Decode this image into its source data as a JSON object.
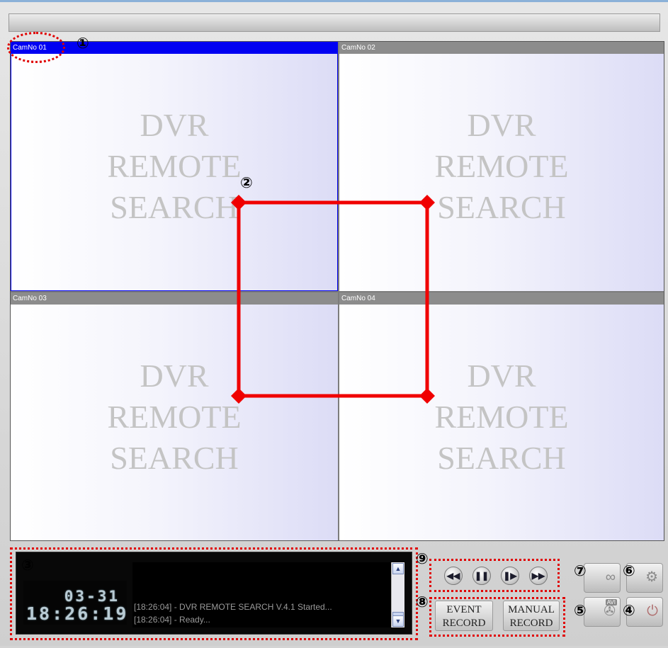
{
  "cameras": [
    {
      "label": "CamNo 01",
      "active": true
    },
    {
      "label": "CamNo 02",
      "active": false
    },
    {
      "label": "CamNo 03",
      "active": false
    },
    {
      "label": "CamNo 04",
      "active": false
    }
  ],
  "watermark": {
    "line1": "DVR",
    "line2": "REMOTE",
    "line3": "SEARCH"
  },
  "status": {
    "date": "03-31",
    "time": "18:26:19"
  },
  "log": {
    "entries": [
      "[18:26:04] - DVR REMOTE SEARCH V.4.1 Started...",
      "[18:26:04] - Ready..."
    ]
  },
  "playback": {
    "rewind_icon": "rewind-icon",
    "pause_icon": "pause-icon",
    "step_forward_icon": "step-forward-icon",
    "fast_forward_icon": "fast-forward-icon"
  },
  "record": {
    "event_line1": "EVENT",
    "event_line2": "RECORD",
    "manual_line1": "MANUAL",
    "manual_line2": "RECORD"
  },
  "tools": {
    "avi_badge": "AVI",
    "connect_icon": "chain-link-icon",
    "settings_icon": "gear-icon",
    "avi_icon": "film-reel-icon",
    "power_icon": "power-icon"
  },
  "callouts": [
    "①",
    "②",
    "③",
    "④",
    "⑤",
    "⑥",
    "⑦",
    "⑧",
    "⑨"
  ],
  "colors": {
    "active_header": "#0000f2",
    "annotation": "#e00000"
  }
}
